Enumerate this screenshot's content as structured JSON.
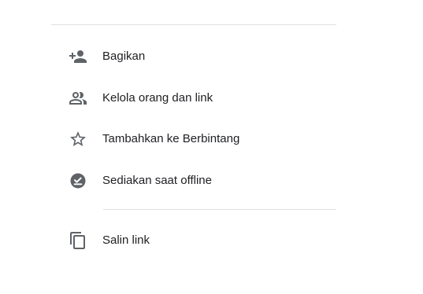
{
  "menu": {
    "items": [
      {
        "label": "Bagikan",
        "icon": "person-add-icon"
      },
      {
        "label": "Kelola orang dan link",
        "icon": "people-outline-icon"
      },
      {
        "label": "Tambahkan ke Berbintang",
        "icon": "star-outline-icon"
      },
      {
        "label": "Sediakan saat offline",
        "icon": "offline-check-icon"
      },
      {
        "label": "Salin link",
        "icon": "copy-icon"
      }
    ]
  },
  "colors": {
    "text": "#202124",
    "icon": "#5f6368",
    "divider": "#e0e0e0",
    "background": "#ffffff"
  }
}
